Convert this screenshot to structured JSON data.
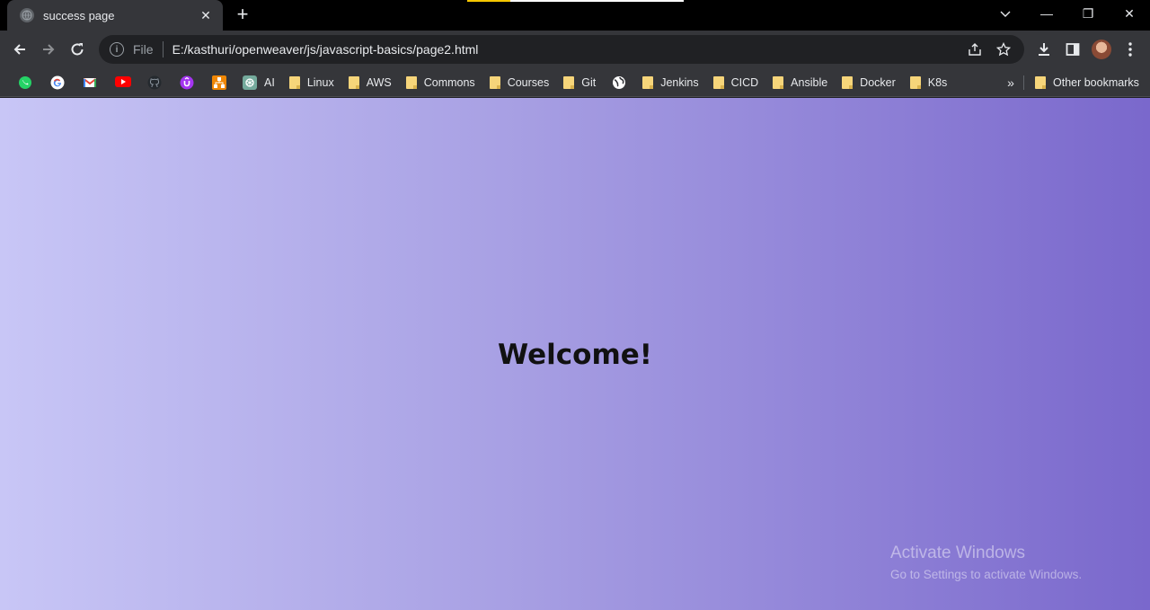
{
  "browser": {
    "tab": {
      "title": "success page",
      "close_glyph": "✕"
    },
    "new_tab_glyph": "+",
    "window_controls": [
      "—",
      "❐",
      "✕"
    ],
    "toolbar": {
      "scheme": "File",
      "url": "E:/kasthuri/openweaver/js/javascript-basics/page2.html"
    },
    "bookmarks": [
      {
        "label": "",
        "icon": "whatsapp-icon",
        "color": "#25d366"
      },
      {
        "label": "",
        "icon": "google-icon",
        "color": "#ffffff"
      },
      {
        "label": "",
        "icon": "gmail-icon",
        "color": "#ffffff"
      },
      {
        "label": "",
        "icon": "youtube-icon",
        "color": "#ff0000"
      },
      {
        "label": "",
        "icon": "github-icon",
        "color": "#24292e"
      },
      {
        "label": "",
        "icon": "udemy-icon",
        "color": "#a435f0"
      },
      {
        "label": "",
        "icon": "diagram-icon",
        "color": "#f08705"
      },
      {
        "label": "AI",
        "icon": "chatgpt-icon",
        "color": "#74aa9c"
      },
      {
        "label": "Linux",
        "icon": "folder-icon"
      },
      {
        "label": "AWS",
        "icon": "folder-icon"
      },
      {
        "label": "Commons",
        "icon": "folder-icon"
      },
      {
        "label": "Courses",
        "icon": "folder-icon"
      },
      {
        "label": "Git",
        "icon": "folder-icon"
      },
      {
        "label": "",
        "icon": "globe-icon",
        "color": "#ffffff"
      },
      {
        "label": "Jenkins",
        "icon": "folder-icon"
      },
      {
        "label": "CICD",
        "icon": "folder-icon"
      },
      {
        "label": "Ansible",
        "icon": "folder-icon"
      },
      {
        "label": "Docker",
        "icon": "folder-icon"
      },
      {
        "label": "K8s",
        "icon": "folder-icon"
      }
    ],
    "bookmarks_more_glyph": "»",
    "other_bookmarks": "Other bookmarks"
  },
  "page": {
    "heading": "Welcome!",
    "watermark_title": "Activate Windows",
    "watermark_subtitle": "Go to Settings to activate Windows."
  },
  "colors": {
    "gradient_start": "#c8c6f6",
    "gradient_end": "#7a68cc"
  }
}
